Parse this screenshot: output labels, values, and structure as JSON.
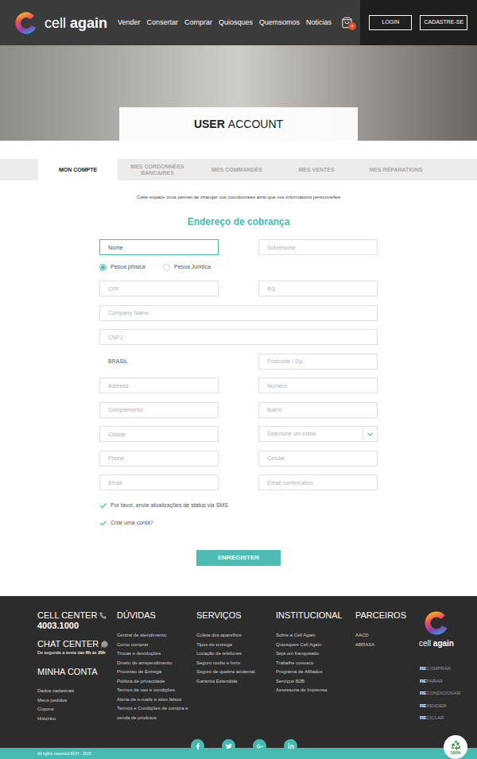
{
  "header": {
    "logo": {
      "light": "cell",
      "bold": "again"
    },
    "nav": [
      "Vender",
      "Consertar",
      "Comprar",
      "Quiosques",
      "Quemsomos",
      "Noticias"
    ],
    "cart_count": "4",
    "buttons": [
      "LOGIN",
      "CADASTRE-SE"
    ]
  },
  "hero": {
    "title_bold": "USER",
    "title_light": "ACCOUNT"
  },
  "tabs": [
    {
      "label": "MON COMPTE",
      "selected": true
    },
    {
      "label": "MES CORDONNÉES BANCAIRES",
      "selected": false
    },
    {
      "label": "MES COMMANDÉS",
      "selected": false
    },
    {
      "label": "MES VENTES",
      "selected": false
    },
    {
      "label": "MES RÉPARATIONS",
      "selected": false
    }
  ],
  "intro": "Cette espace vous permet de changer vos coordonnées ainsi que vos informations personnelles",
  "form": {
    "title": "Endereço de cobrança",
    "rows": [
      {
        "kind": "fields",
        "fields": [
          {
            "kind": "input",
            "text": "Nome",
            "focused": true
          },
          {
            "kind": "input",
            "text": "Sobrenome",
            "focused": false
          }
        ]
      },
      {
        "kind": "radios",
        "options": [
          {
            "label": "Pesoa phisica",
            "selected": true
          },
          {
            "label": "Pesoa Juridica",
            "selected": false
          }
        ]
      },
      {
        "kind": "fields",
        "fields": [
          {
            "kind": "input",
            "text": "CPF",
            "focused": false
          },
          {
            "kind": "input",
            "text": "RG",
            "focused": false
          }
        ]
      },
      {
        "kind": "fields",
        "fields": [
          {
            "kind": "input",
            "text": "Company Name",
            "focused": false
          }
        ]
      },
      {
        "kind": "fields",
        "fields": [
          {
            "kind": "input",
            "text": "CNPJ",
            "focused": false
          }
        ]
      },
      {
        "kind": "fields",
        "fields": [
          {
            "kind": "value",
            "text": "BRASIL",
            "focused": false
          },
          {
            "kind": "input",
            "text": "Postcode /  Zip",
            "focused": false
          }
        ]
      },
      {
        "kind": "fields",
        "fields": [
          {
            "kind": "input",
            "text": "Address",
            "focused": false
          },
          {
            "kind": "input",
            "text": "Numero",
            "focused": false
          }
        ]
      },
      {
        "kind": "fields",
        "fields": [
          {
            "kind": "input",
            "text": "Complemento",
            "focused": false
          },
          {
            "kind": "input",
            "text": "Bairro",
            "focused": false
          }
        ]
      },
      {
        "kind": "fields",
        "fields": [
          {
            "kind": "input",
            "text": "Cidade",
            "focused": false
          },
          {
            "kind": "select",
            "text": "Selecione um estdo",
            "focused": false
          }
        ]
      },
      {
        "kind": "fields",
        "fields": [
          {
            "kind": "input",
            "text": "Phone",
            "focused": false
          },
          {
            "kind": "input",
            "text": "Celular",
            "focused": false
          }
        ]
      },
      {
        "kind": "fields",
        "fields": [
          {
            "kind": "input",
            "text": "Email",
            "focused": false
          },
          {
            "kind": "input",
            "text": "Email confirmation",
            "focused": false
          }
        ]
      }
    ],
    "checkboxes": [
      {
        "label": "Por favor, envie atualizações de status via SMS",
        "checked": true
      },
      {
        "label": "Criar uma conta?",
        "checked": true
      }
    ],
    "submit": "ENREGISTER"
  },
  "footer": {
    "cell_center": {
      "title": "CELL CENTER",
      "number": "4003.1000"
    },
    "chat_center": {
      "title": "CHAT CENTER",
      "hours": [
        {
          "text": "De segunda a sexta das ",
          "bold": false
        },
        {
          "text": "6h",
          "bold": true
        },
        {
          "text": " às ",
          "bold": false
        },
        {
          "text": "20h",
          "bold": true
        }
      ]
    },
    "account": {
      "title": "MINHA CONTA",
      "links": [
        "Dados cadastrais",
        "Meus pedidos",
        "Cupons",
        "Histórico"
      ]
    },
    "columns": [
      {
        "title": "DÚVIDAS",
        "links": [
          "Central de atendimento",
          "Como comprar",
          "Trocas e devoluções",
          "Direito de arrependimento",
          "Processo de Entrega",
          "Política de privacidade",
          "Termos de uso e condições",
          "Alerta de e-mails e sites falsos",
          "Termos e Condições de compra e venda de produtos"
        ]
      },
      {
        "title": "SERVIÇOS",
        "links": [
          "Coleta dos aparelhos",
          "Tipos de entrega",
          "Locação de telefones",
          "Seguro roubo e furto",
          "Seguro de quebra acidental",
          "Garantia Estendida"
        ]
      },
      {
        "title": "INSTITUCIONAL",
        "links": [
          "Sobre a Cell Again",
          "Quiosques Cell Again",
          "Seja um franqueado",
          "Trabalhe conosco",
          "Programa de Afiliados",
          "Serviços B2B",
          "Assessoria de Imprensa"
        ]
      },
      {
        "title": "PARCEIROS",
        "links": [
          "AACD",
          "ABRASA"
        ]
      }
    ],
    "logo": {
      "light": "cell",
      "bold": "again"
    },
    "re_items": [
      {
        "prefix": "RE",
        "rest": "COMPRAR"
      },
      {
        "prefix": "RE",
        "rest": "PARAR"
      },
      {
        "prefix": "RE",
        "rest": "CONDICIONAR"
      },
      {
        "prefix": "RE",
        "rest": "VENDER"
      },
      {
        "prefix": "RE",
        "rest": "CICLAR"
      }
    ],
    "badge": "100%",
    "copyright": "All rights reserved BGH - 2015"
  }
}
